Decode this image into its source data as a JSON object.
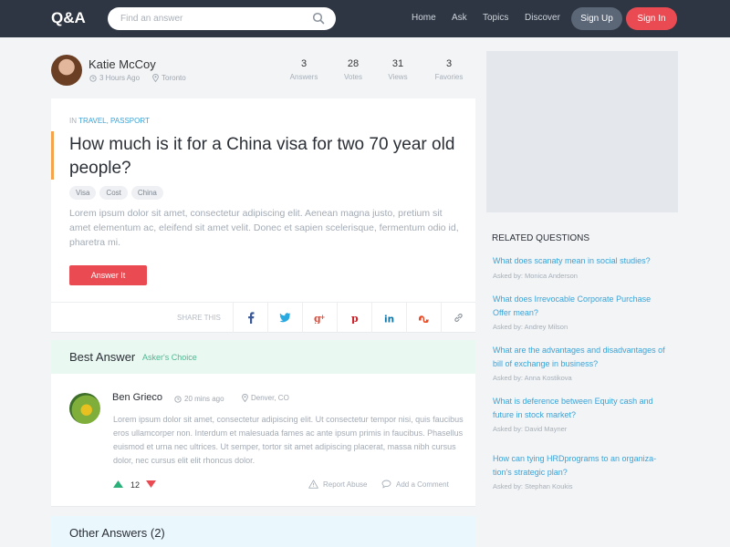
{
  "nav": {
    "logo": "Q&A",
    "search_placeholder": "Find an answer",
    "links": [
      "Home",
      "Ask",
      "Topics",
      "Discover"
    ],
    "signup_label": "Sign Up",
    "signin_label": "Sign In"
  },
  "question": {
    "author": "Katie McCoy",
    "time": "3 Hours Ago",
    "location": "Toronto",
    "stats": [
      {
        "value": "3",
        "label": "Answers"
      },
      {
        "value": "28",
        "label": "Votes"
      },
      {
        "value": "31",
        "label": "Views"
      },
      {
        "value": "3",
        "label": "Favories"
      }
    ],
    "in_label": "IN",
    "categories": "TRAVEL, PASSPORT",
    "title": "How much is it for a China visa for two 70 year old people?",
    "tags": [
      "Visa",
      "Cost",
      "China"
    ],
    "body": "Lorem ipsum dolor sit amet, consectetur adipiscing elit. Aenean magna justo, pretium sit amet elementum ac, eleifend sit amet velit. Donec et sapien scelerisque, fermentum odio id, pharetra mi.",
    "answer_button": "Answer It",
    "share_label": "SHARE THIS",
    "share_icons": [
      "facebook-icon",
      "twitter-icon",
      "google-plus-icon",
      "pinterest-icon",
      "linkedin-icon",
      "stumbleupon-icon",
      "link-icon"
    ]
  },
  "best_answer": {
    "heading": "Best Answer",
    "badge": "Asker's Choice",
    "author": "Ben Grieco",
    "time": "20 mins ago",
    "location": "Denver, CO",
    "body": "Lorem ipsum dolor sit amet, consectetur adipiscing elit. Ut consectetur tempor nisi, quis faucibus eros ullamcorper non. Interdum et malesuada fames ac ante ipsum primis in faucibus. Phasellus euismod et urna nec ultrices. Ut semper, tortor sit amet adipiscing placerat, massa nibh cursus dolor, nec cursus elit elit rhoncus dolor.",
    "votes": "12",
    "report_label": "Report Abuse",
    "comment_label": "Add a Comment"
  },
  "other_answers": {
    "heading": "Other Answers (2)"
  },
  "sidebar": {
    "related_title": "RELATED QUESTIONS",
    "asked_by_prefix": "Asked by:",
    "items": [
      {
        "question": "What does scanaty mean in social studies?",
        "asked_by": "Asked by: Monica Anderson"
      },
      {
        "question": "What does Irrevocable Corporate Purchase Offer mean?",
        "asked_by": "Asked by: Andrey Milson"
      },
      {
        "question": "What are the advantages and disadvantages of bill of exchange in business?",
        "asked_by": "Asked by: Anna Kostikova"
      },
      {
        "question": "What is deference between Equity cash and future in stock market?",
        "asked_by": "Asked by: David Mayner"
      },
      {
        "question": "How can tying HRDprograms to an organiza-tion's strategic plan?",
        "asked_by": "Asked by: Stephan Koukis"
      }
    ]
  },
  "colors": {
    "nav_bg": "#2e3643",
    "accent_red": "#ea4b52",
    "link_blue": "#3aa3d8",
    "accent_orange": "#f5a44b",
    "best_green": "#4cb890"
  }
}
